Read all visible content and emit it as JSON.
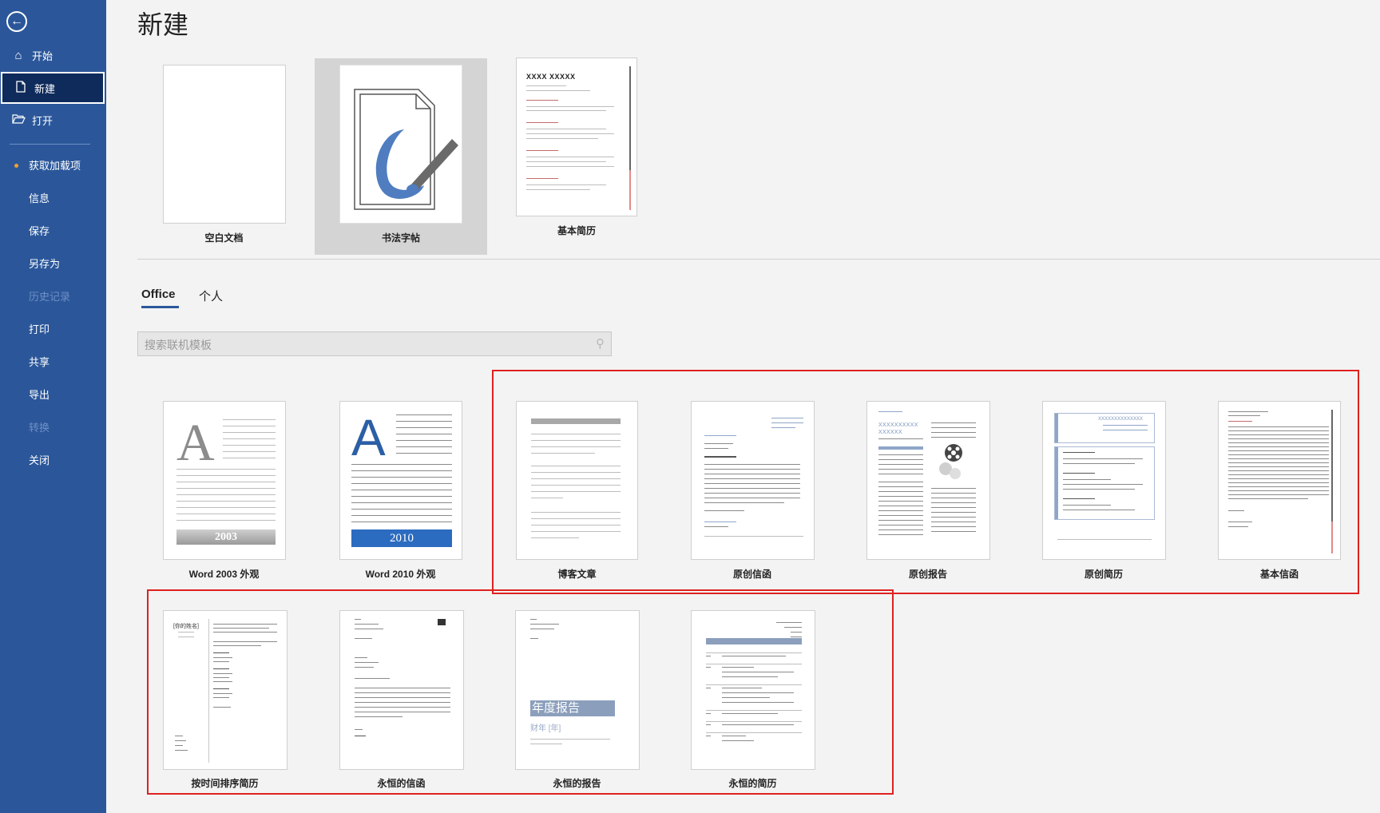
{
  "sidebar": {
    "back_icon": "back-arrow-icon",
    "items": [
      {
        "label": "开始",
        "icon": "home-icon"
      },
      {
        "label": "新建",
        "icon": "new-document-icon"
      },
      {
        "label": "打开",
        "icon": "open-folder-icon"
      },
      {
        "label": "获取加载项"
      },
      {
        "label": "信息"
      },
      {
        "label": "保存"
      },
      {
        "label": "另存为"
      },
      {
        "label": "历史记录"
      },
      {
        "label": "打印"
      },
      {
        "label": "共享"
      },
      {
        "label": "导出"
      },
      {
        "label": "转换"
      },
      {
        "label": "关闭"
      }
    ],
    "active_item": "新建",
    "disabled_items": [
      "历史记录",
      "转换"
    ]
  },
  "main": {
    "title": "新建",
    "featured": [
      {
        "label": "空白文档"
      },
      {
        "label": "书法字帖"
      },
      {
        "label": "基本简历",
        "thumb_title": "XXXX XXXXX"
      }
    ],
    "tabs": [
      {
        "label": "Office"
      },
      {
        "label": "个人"
      }
    ],
    "active_tab": "Office",
    "search": {
      "placeholder": "搜索联机模板"
    },
    "templates": [
      {
        "label": "Word 2003 外观",
        "badge": "2003",
        "big_letter": "A"
      },
      {
        "label": "Word 2010 外观",
        "badge": "2010",
        "big_letter": "A"
      },
      {
        "label": "博客文章"
      },
      {
        "label": "原创信函"
      },
      {
        "label": "原创报告"
      },
      {
        "label": "原创简历"
      },
      {
        "label": "基本信函"
      },
      {
        "label": "按时间排序简历",
        "thumb_title": "[你的姓名]"
      },
      {
        "label": "永恒的信函"
      },
      {
        "label": "永恒的报告",
        "thumb_title": "年度报告",
        "thumb_subtitle": "财年 [年]"
      },
      {
        "label": "永恒的简历"
      }
    ]
  },
  "colors": {
    "sidebar_bg": "#2b579a",
    "sidebar_active_bg": "#0f2b5b",
    "accent": "#2b579a",
    "highlight_box": "#e02020",
    "page_bg": "#f3f3f3"
  }
}
